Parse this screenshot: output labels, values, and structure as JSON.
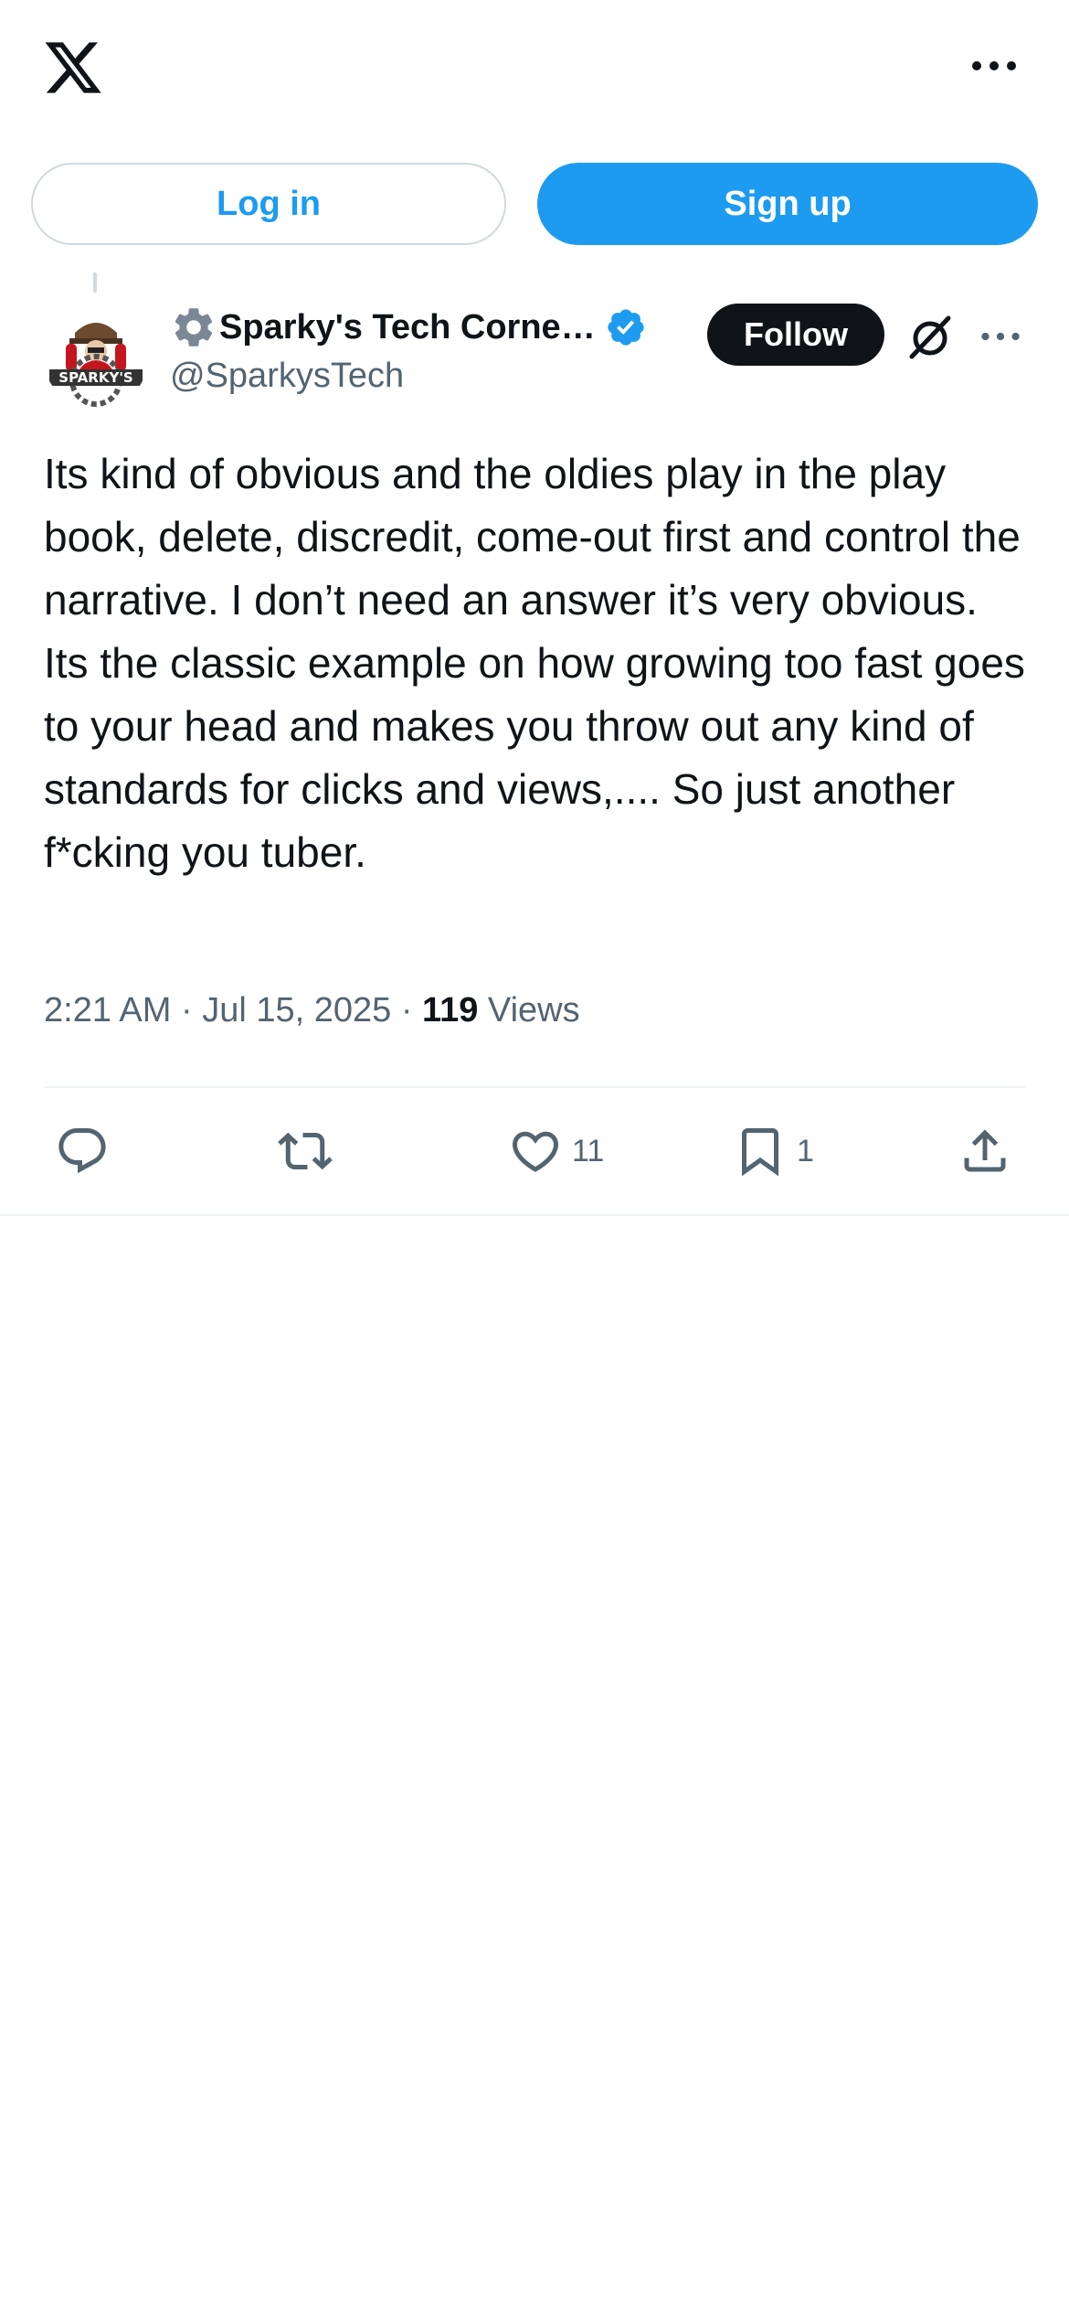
{
  "header": {
    "logo_icon": "x-logo-icon",
    "more_icon": "more-horizontal-icon"
  },
  "auth": {
    "login_label": "Log in",
    "signup_label": "Sign up"
  },
  "post": {
    "author": {
      "name_prefix_icon": "gear-emoji-icon",
      "display_name": "Sparky's Tech Corne…",
      "handle": "@SparkysTech",
      "verified": true,
      "avatar_text": "SPARKY'S"
    },
    "follow_label": "Follow",
    "text": "Its kind of obvious and the oldies play in the play book, delete, discredit, come-out first and control the narrative. I don’t need an answer it’s very obvious.\nIts the classic example on how growing too fast goes to your head and makes you throw out any kind of standards for clicks and views,.... So just another f*cking you tuber.",
    "time": "2:21 AM",
    "date": "Jul 15, 2025",
    "separator": "·",
    "views_count": "119",
    "views_label": "Views",
    "actions": {
      "reply_count": "",
      "repost_count": "",
      "like_count": "11",
      "bookmark_count": "1"
    }
  },
  "colors": {
    "accent": "#1d9bf0",
    "text_primary": "#0f1419",
    "text_secondary": "#536471",
    "border": "#cfd9de",
    "divider": "#eff3f4"
  }
}
